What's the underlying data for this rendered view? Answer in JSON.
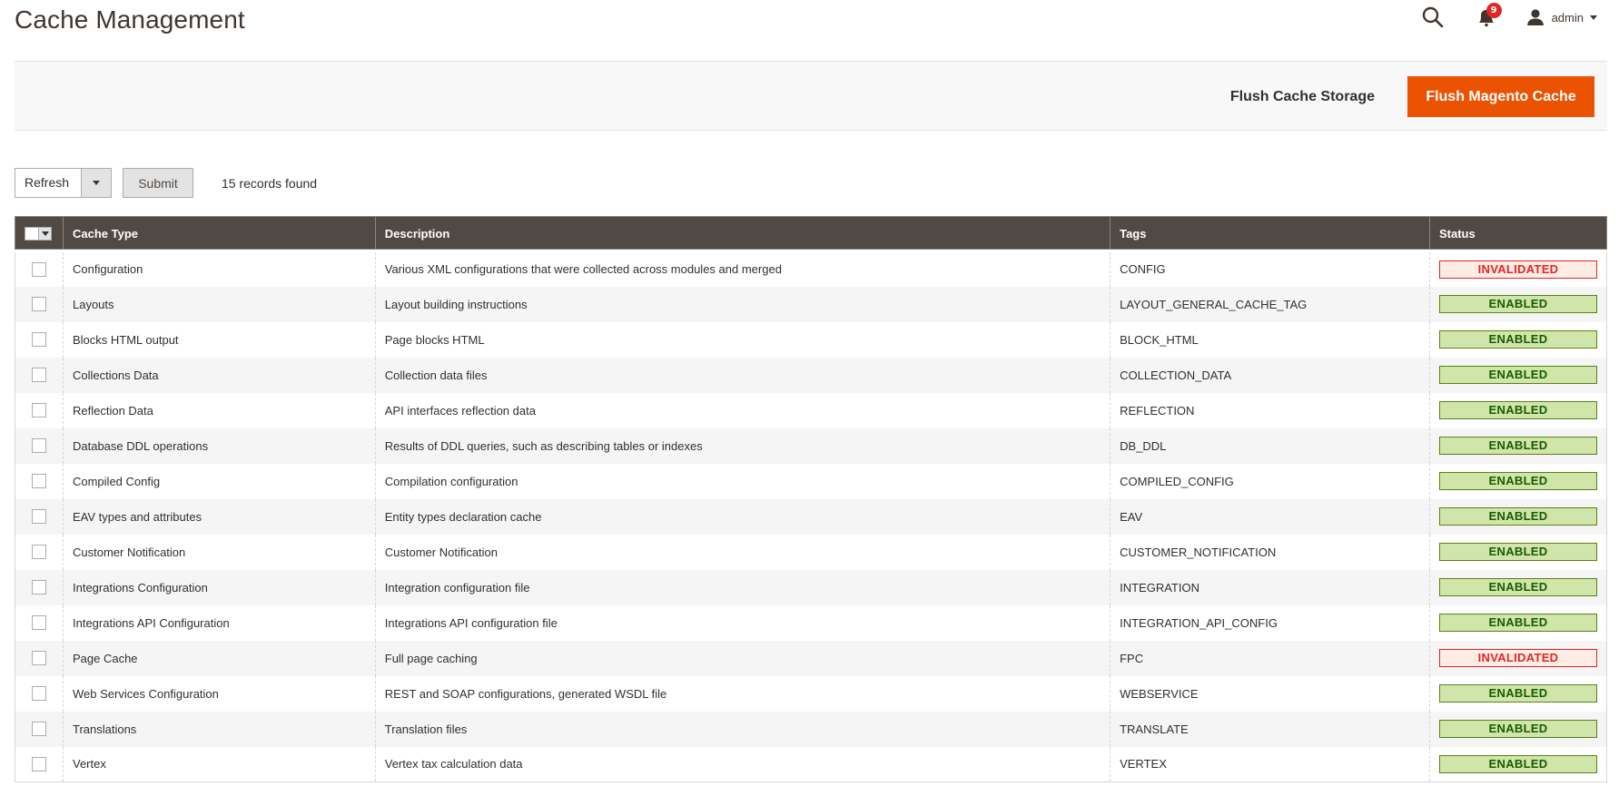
{
  "page": {
    "title": "Cache Management"
  },
  "header": {
    "search_icon": "search-icon",
    "notifications": {
      "icon": "bell-icon",
      "count": "9"
    },
    "user": {
      "icon": "user-icon",
      "name": "admin"
    }
  },
  "actions": {
    "flush_storage_label": "Flush Cache Storage",
    "flush_magento_label": "Flush Magento Cache",
    "accent_color": "#eb5202"
  },
  "mass_action": {
    "selected": "Refresh",
    "submit_label": "Submit",
    "records_found": "15 records found"
  },
  "table": {
    "columns": [
      "Cache Type",
      "Description",
      "Tags",
      "Status"
    ],
    "rows": [
      {
        "type": "Configuration",
        "description": "Various XML configurations that were collected across modules and merged",
        "tags": "CONFIG",
        "status": "INVALIDATED"
      },
      {
        "type": "Layouts",
        "description": "Layout building instructions",
        "tags": "LAYOUT_GENERAL_CACHE_TAG",
        "status": "ENABLED"
      },
      {
        "type": "Blocks HTML output",
        "description": "Page blocks HTML",
        "tags": "BLOCK_HTML",
        "status": "ENABLED"
      },
      {
        "type": "Collections Data",
        "description": "Collection data files",
        "tags": "COLLECTION_DATA",
        "status": "ENABLED"
      },
      {
        "type": "Reflection Data",
        "description": "API interfaces reflection data",
        "tags": "REFLECTION",
        "status": "ENABLED"
      },
      {
        "type": "Database DDL operations",
        "description": "Results of DDL queries, such as describing tables or indexes",
        "tags": "DB_DDL",
        "status": "ENABLED"
      },
      {
        "type": "Compiled Config",
        "description": "Compilation configuration",
        "tags": "COMPILED_CONFIG",
        "status": "ENABLED"
      },
      {
        "type": "EAV types and attributes",
        "description": "Entity types declaration cache",
        "tags": "EAV",
        "status": "ENABLED"
      },
      {
        "type": "Customer Notification",
        "description": "Customer Notification",
        "tags": "CUSTOMER_NOTIFICATION",
        "status": "ENABLED"
      },
      {
        "type": "Integrations Configuration",
        "description": "Integration configuration file",
        "tags": "INTEGRATION",
        "status": "ENABLED"
      },
      {
        "type": "Integrations API Configuration",
        "description": "Integrations API configuration file",
        "tags": "INTEGRATION_API_CONFIG",
        "status": "ENABLED"
      },
      {
        "type": "Page Cache",
        "description": "Full page caching",
        "tags": "FPC",
        "status": "INVALIDATED"
      },
      {
        "type": "Web Services Configuration",
        "description": "REST and SOAP configurations, generated WSDL file",
        "tags": "WEBSERVICE",
        "status": "ENABLED"
      },
      {
        "type": "Translations",
        "description": "Translation files",
        "tags": "TRANSLATE",
        "status": "ENABLED"
      },
      {
        "type": "Vertex",
        "description": "Vertex tax calculation data",
        "tags": "VERTEX",
        "status": "ENABLED"
      }
    ]
  },
  "status_colors": {
    "ENABLED": {
      "bg": "#d0e5a9",
      "border": "#5b8116",
      "text": "#185b00"
    },
    "INVALIDATED": {
      "bg": "#ffece5",
      "border": "#e22626",
      "text": "#e22626"
    }
  }
}
